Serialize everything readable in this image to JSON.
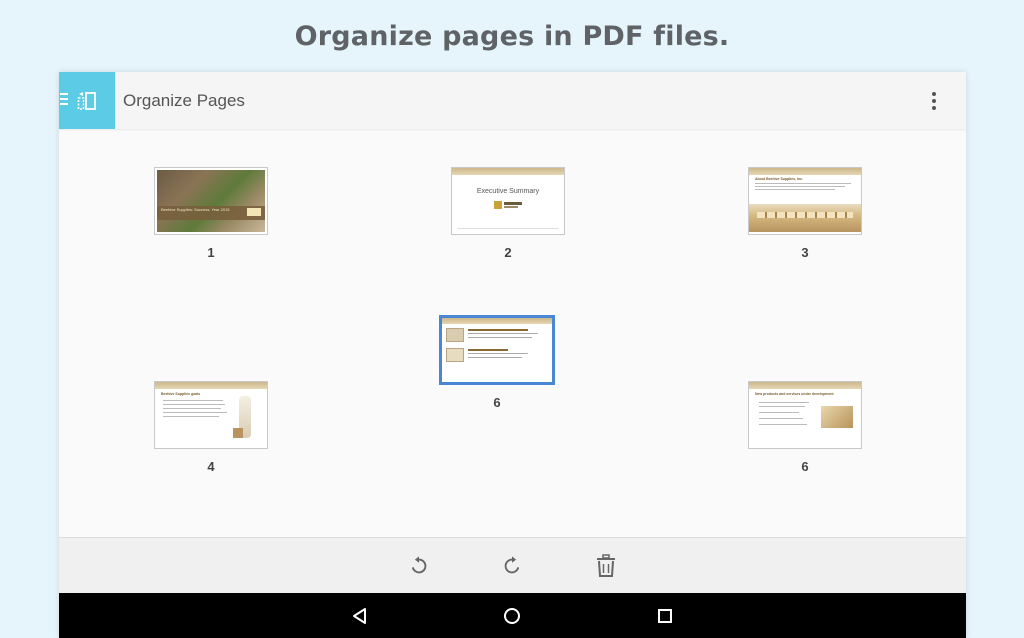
{
  "promo": {
    "title": "Organize pages in PDF files."
  },
  "app_bar": {
    "title": "Organize Pages",
    "nav_icon": "organize-pages-icon",
    "menu_icon": "more-vert-icon"
  },
  "pages": [
    {
      "label": "1",
      "thumb_title": "Beehive Supplies: Success, Year 2015"
    },
    {
      "label": "2",
      "thumb_title": "Executive Summary"
    },
    {
      "label": "3",
      "thumb_title": "About Beehive Supplies, Inc."
    },
    {
      "label": "4",
      "thumb_title": "Beehive Supplies goals"
    },
    {
      "label": "6",
      "thumb_title": "",
      "selected": true
    },
    {
      "label": "6",
      "thumb_title": "New products and services under development"
    }
  ],
  "toolbar": {
    "rotate_left_icon": "rotate-left-icon",
    "rotate_right_icon": "rotate-right-icon",
    "delete_icon": "trash-icon"
  },
  "system_nav": {
    "back_icon": "back-triangle-icon",
    "home_icon": "home-circle-icon",
    "recents_icon": "recents-square-icon"
  },
  "colors": {
    "accent": "#5ccbe6",
    "selection": "#4a86d6",
    "background": "#e5f5fb"
  }
}
